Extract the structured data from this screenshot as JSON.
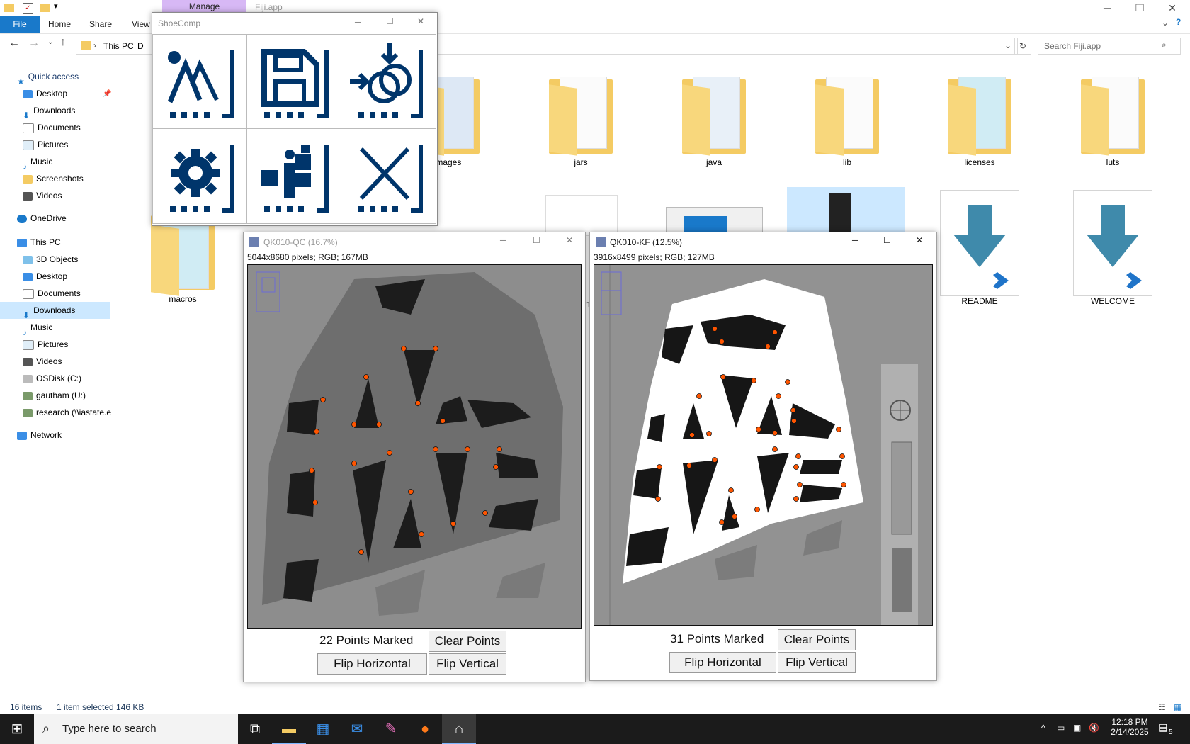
{
  "explorer": {
    "manage_tab": "Manage",
    "window_title": "Fiji.app",
    "tabs": [
      "File",
      "Home",
      "Share",
      "View"
    ],
    "breadcrumb": [
      "This PC",
      "D"
    ],
    "search_placeholder": "Search Fiji.app",
    "nav": {
      "quick_access": "Quick access",
      "quick_items": [
        "Desktop",
        "Downloads",
        "Documents",
        "Pictures",
        "Music",
        "Screenshots",
        "Videos"
      ],
      "onedrive": "OneDrive",
      "this_pc": "This PC",
      "pc_items": [
        "3D Objects",
        "Desktop",
        "Documents",
        "Downloads",
        "Music",
        "Pictures",
        "Videos",
        "OSDisk (C:)",
        "gautham (U:)",
        "research (\\\\iastate.e"
      ],
      "network": "Network"
    },
    "files": [
      "images",
      "jars",
      "java",
      "lib",
      "licenses",
      "luts",
      "macros",
      "nl.gz",
      "README",
      "WELCOME"
    ],
    "status": {
      "items": "16 items",
      "selected": "1 item selected  146 KB"
    }
  },
  "shoecomp": {
    "title": "ShoeComp"
  },
  "win_qc": {
    "title": "QK010-QC (16.7%)",
    "info": "5044x8680 pixels; RGB; 167MB",
    "points_label": "22 Points Marked",
    "clear": "Clear Points",
    "flip_h": "Flip Horizontal",
    "flip_v": "Flip Vertical"
  },
  "win_kf": {
    "title": "QK010-KF (12.5%)",
    "info": "3916x8499 pixels; RGB; 127MB",
    "points_label": "31 Points Marked",
    "clear": "Clear Points",
    "flip_h": "Flip Horizontal",
    "flip_v": "Flip Vertical"
  },
  "taskbar": {
    "search_placeholder": "Type here to search",
    "time": "12:18 PM",
    "date": "2/14/2025",
    "notifications": "5"
  },
  "colors": {
    "accent": "#1979ca",
    "point": "#ff5500",
    "tool_blue": "#00356b"
  }
}
